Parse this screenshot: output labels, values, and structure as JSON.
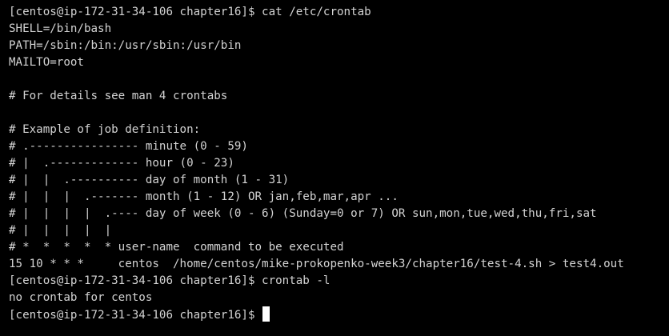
{
  "terminal": {
    "colors": {
      "background": "#000000",
      "foreground": "#d3d3d3",
      "cursor": "#ffffff"
    },
    "lines": [
      "[centos@ip-172-31-34-106 chapter16]$ cat /etc/crontab",
      "SHELL=/bin/bash",
      "PATH=/sbin:/bin:/usr/sbin:/usr/bin",
      "MAILTO=root",
      "",
      "# For details see man 4 crontabs",
      "",
      "# Example of job definition:",
      "# .---------------- minute (0 - 59)",
      "# |  .------------- hour (0 - 23)",
      "# |  |  .---------- day of month (1 - 31)",
      "# |  |  |  .------- month (1 - 12) OR jan,feb,mar,apr ...",
      "# |  |  |  |  .---- day of week (0 - 6) (Sunday=0 or 7) OR sun,mon,tue,wed,thu,fri,sat",
      "# |  |  |  |  |",
      "# *  *  *  *  * user-name  command to be executed",
      "15 10 * * *     centos  /home/centos/mike-prokopenko-week3/chapter16/test-4.sh > test4.out",
      "[centos@ip-172-31-34-106 chapter16]$ crontab -l",
      "no crontab for centos"
    ],
    "prompt": "[centos@ip-172-31-34-106 chapter16]$ "
  }
}
